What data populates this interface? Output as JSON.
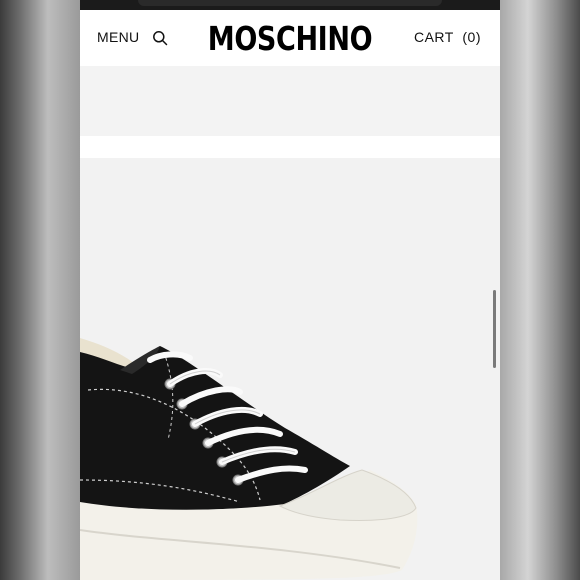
{
  "header": {
    "menu_label": "MENU",
    "brand": "MOSCHINO",
    "cart_label": "CART",
    "cart_count": "(0)"
  },
  "icons": {
    "search": "search-icon"
  },
  "colors": {
    "header_bg": "#ffffff",
    "page_bg": "#f4f4f4",
    "text": "#111111"
  }
}
